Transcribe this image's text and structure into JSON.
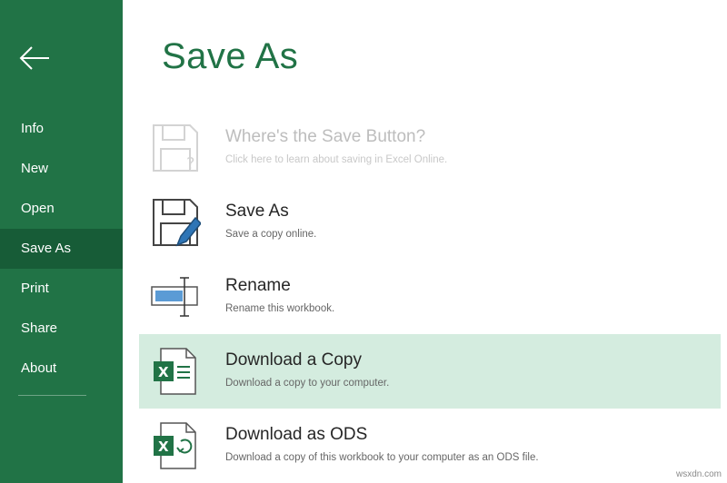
{
  "sidebar": {
    "items": [
      {
        "label": "Info"
      },
      {
        "label": "New"
      },
      {
        "label": "Open"
      },
      {
        "label": "Save As"
      },
      {
        "label": "Print"
      },
      {
        "label": "Share"
      },
      {
        "label": "About"
      }
    ],
    "active_item": "Save As",
    "background_color": "#217346",
    "active_color": "#175c37"
  },
  "main": {
    "title": "Save As",
    "options": [
      {
        "title": "Where's the Save Button?",
        "description": "Click here to learn about saving in Excel Online.",
        "icon": "floppy-question-icon",
        "state": "faded"
      },
      {
        "title": "Save As",
        "description": "Save a copy online.",
        "icon": "floppy-pencil-icon",
        "state": "normal"
      },
      {
        "title": "Rename",
        "description": "Rename this workbook.",
        "icon": "rename-icon",
        "state": "normal"
      },
      {
        "title": "Download a Copy",
        "description": "Download a copy to your computer.",
        "icon": "excel-file-icon",
        "state": "selected"
      },
      {
        "title": "Download as ODS",
        "description": "Download a copy of this workbook to your computer as an ODS file.",
        "icon": "excel-ods-icon",
        "state": "normal"
      }
    ],
    "accent_color": "#217346",
    "selected_color": "#d4ecdf"
  },
  "watermark": "wsxdn.com"
}
